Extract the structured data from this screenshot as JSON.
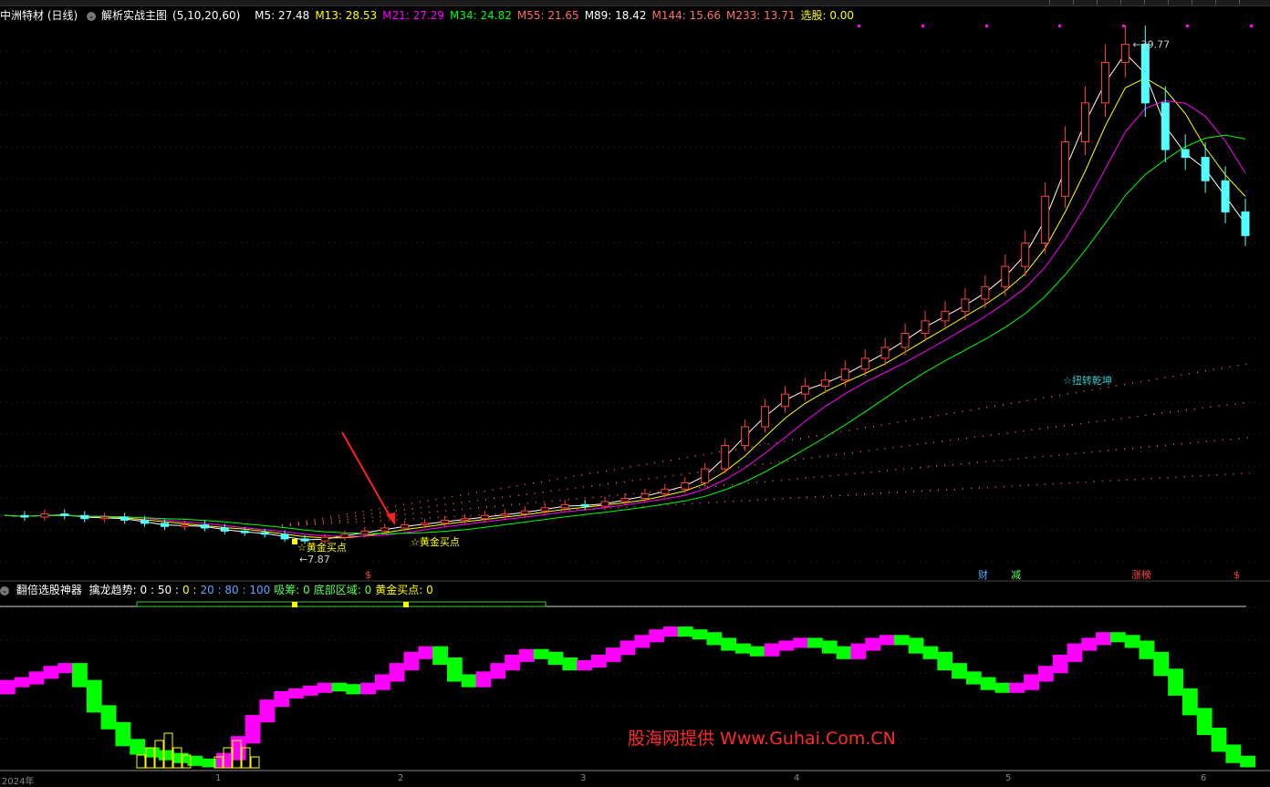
{
  "toolbar": {
    "buttons": 9
  },
  "main_legend": {
    "stock_name": "中洲特材 (日线)",
    "indicator_name": "解析实战主图",
    "params": "(5,10,20,60)",
    "ma_values": [
      {
        "label": "M5:",
        "value": "27.48",
        "color": "#ffffff"
      },
      {
        "label": "M13:",
        "value": "28.53",
        "color": "#ffff00"
      },
      {
        "label": "M21:",
        "value": "27.29",
        "color": "#ff00ff"
      },
      {
        "label": "M34:",
        "value": "24.82",
        "color": "#00ff00"
      },
      {
        "label": "M55:",
        "value": "21.65",
        "color": "#ff6a6a"
      },
      {
        "label": "M89:",
        "value": "18.42",
        "color": "#ffffff"
      },
      {
        "label": "M144:",
        "value": "15.66",
        "color": "#ff7070"
      },
      {
        "label": "M233:",
        "value": "13.71",
        "color": "#ff7070"
      },
      {
        "label": "选股:",
        "value": "0.00",
        "color": "#ffff00"
      }
    ]
  },
  "annotations": {
    "high_label": "39.77",
    "low_label": "7.87",
    "golden_buy_1": "☆黄金买点",
    "golden_buy_2": "☆黄金买点",
    "reverse_label": "扭转乾坤",
    "markers": [
      "$",
      "财",
      "减",
      "涨榜",
      "$"
    ]
  },
  "indicator_legend": {
    "name": "翻倍选股神器",
    "parts": [
      {
        "text": "擒龙趋势: 0 : 50 :",
        "color": "#ffffff"
      },
      {
        "text": "0 :",
        "color": "#ffff00"
      },
      {
        "text": "20 : 80 : 100",
        "color": "#55aaff"
      },
      {
        "text": "吸筹: 0",
        "color": "#55ff55"
      },
      {
        "text": "底部区域: 0",
        "color": "#55ff55"
      },
      {
        "text": "黄金买点: 0",
        "color": "#ffff00"
      }
    ]
  },
  "date_axis": [
    "2024年",
    "1",
    "2",
    "3",
    "4",
    "5",
    "6"
  ],
  "watermark": "股海网提供 Www.Guhai.Com.CN",
  "chart_data": {
    "type": "line",
    "title": "中洲特材 (日线)",
    "price_high": 39.77,
    "price_low": 7.87,
    "price_series": [
      9.5,
      9.4,
      9.6,
      9.5,
      9.3,
      9.4,
      9.2,
      9.0,
      8.8,
      8.9,
      8.7,
      8.5,
      8.4,
      8.3,
      8.0,
      7.87,
      8.1,
      8.3,
      8.5,
      8.7,
      8.9,
      9.0,
      9.2,
      9.3,
      9.5,
      9.6,
      9.8,
      10.0,
      10.2,
      10.1,
      10.4,
      10.6,
      10.9,
      11.2,
      11.6,
      12.5,
      14.0,
      15.2,
      16.5,
      17.3,
      17.8,
      18.2,
      18.9,
      19.6,
      20.3,
      21.2,
      22.0,
      22.6,
      23.4,
      24.2,
      25.5,
      27.0,
      30.0,
      33.5,
      36.0,
      38.6,
      39.77,
      36.0,
      33.0,
      32.5,
      31.0,
      29.0,
      27.48
    ],
    "indicator": {
      "name": "擒龙趋势",
      "levels": [
        0,
        20,
        50,
        80,
        100
      ],
      "values": [
        55,
        60,
        62,
        66,
        70,
        72,
        60,
        42,
        30,
        18,
        12,
        10,
        8,
        6,
        4,
        3,
        8,
        20,
        35,
        46,
        52,
        54,
        56,
        58,
        57,
        55,
        58,
        64,
        72,
        80,
        84,
        76,
        64,
        60,
        66,
        72,
        78,
        82,
        80,
        76,
        72,
        74,
        78,
        83,
        88,
        92,
        96,
        98,
        96,
        94,
        90,
        86,
        84,
        82,
        86,
        88,
        90,
        88,
        84,
        80,
        86,
        90,
        92,
        90,
        84,
        80,
        72,
        66,
        62,
        58,
        56,
        58,
        64,
        70,
        78,
        86,
        90,
        94,
        92,
        88,
        80,
        68,
        54,
        40,
        26,
        14,
        6,
        3
      ]
    }
  }
}
